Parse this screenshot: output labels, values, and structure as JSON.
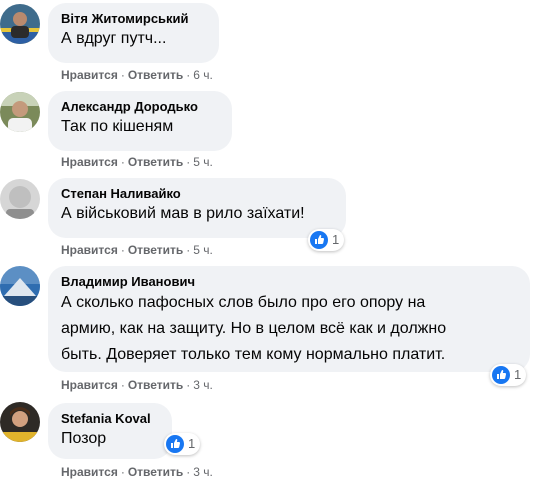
{
  "comments": [
    {
      "author": "Вітя Житомирський",
      "text": "А вдруг путч...",
      "like_label": "Нравится",
      "reply_label": "Ответить",
      "time": "6 ч.",
      "reactions": null
    },
    {
      "author": "Александр Дородько",
      "text": "Так по кішеням",
      "like_label": "Нравится",
      "reply_label": "Ответить",
      "time": "5 ч.",
      "reactions": null
    },
    {
      "author": "Степан Наливайко",
      "text": "А військовий мав в рило заїхати!",
      "like_label": "Нравится",
      "reply_label": "Ответить",
      "time": "5 ч.",
      "reactions": "1"
    },
    {
      "author": "Владимир Иванович",
      "text_lines": [
        "А сколько пафосных слов было про его опору на",
        "армию, как на защиту. Но в целом всё как и должно",
        "быть. Доверяет только тем кому нормально платит."
      ],
      "like_label": "Нравится",
      "reply_label": "Ответить",
      "time": "3 ч.",
      "reactions": "1"
    },
    {
      "author": "Stefania Koval",
      "text": "Позор",
      "like_label": "Нравится",
      "reply_label": "Ответить",
      "time": "3 ч.",
      "reactions": "1"
    }
  ],
  "separator": "·",
  "colors": {
    "bubble": "#f0f2f5",
    "meta": "#65676b",
    "like_blue": "#1877f2"
  },
  "icons": {
    "reaction": "like-thumbs-up-icon"
  }
}
